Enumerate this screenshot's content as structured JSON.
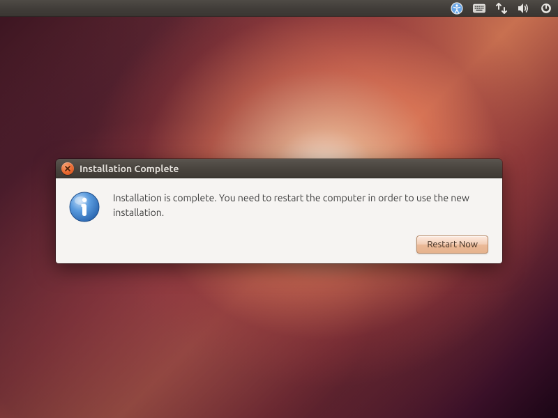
{
  "panel": {
    "icons": [
      "accessibility-icon",
      "keyboard-icon",
      "network-icon",
      "volume-icon",
      "power-icon"
    ]
  },
  "dialog": {
    "title": "Installation Complete",
    "message": "Installation is complete. You need to restart the computer in order to use the new installation.",
    "restart_label": "Restart Now"
  }
}
